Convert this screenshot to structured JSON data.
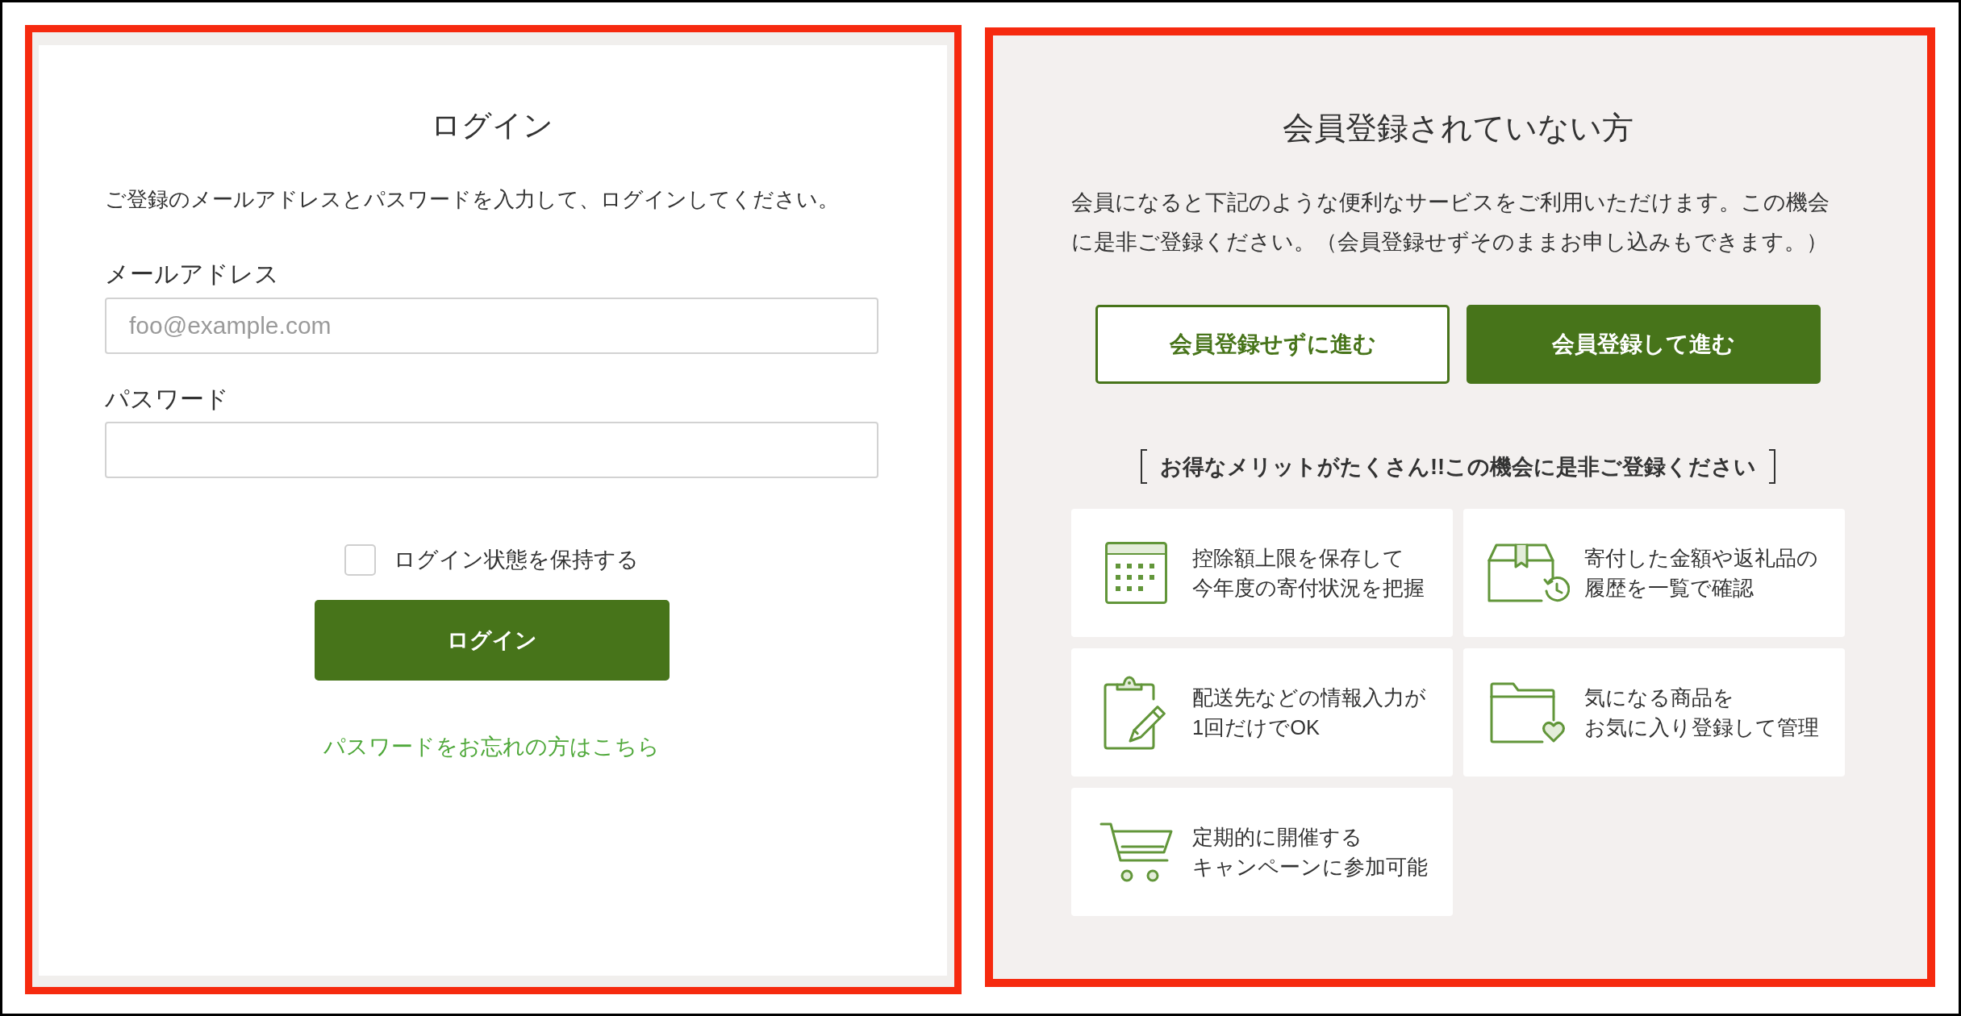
{
  "login": {
    "title": "ログイン",
    "description": "ご登録のメールアドレスとパスワードを入力して、ログインしてください。",
    "fields": [
      {
        "label": "メールアドレス",
        "placeholder": "foo@example.com"
      },
      {
        "label": "パスワード"
      }
    ],
    "remember": {
      "label": "ログイン状態を保持する",
      "checked": false
    },
    "submit_button": "ログイン",
    "forgot_link": "パスワードをお忘れの方はこちら"
  },
  "guest": {
    "title": "会員登録されていない方",
    "description": "会員になると下記のような便利なサービスをご利用いただけます。この機会に是非ご登録ください。（会員登録せずそのままお申し込みもできます。）",
    "buttons": [
      {
        "label": "会員登録せずに進む",
        "kind": "outline"
      },
      {
        "label": "会員登録して進む",
        "kind": "filled"
      }
    ],
    "benefits_heading": "お得なメリットがたくさん!!この機会に是非ご登録ください",
    "benefits": [
      {
        "lines": [
          "控除額上限を保存して",
          "今年度の寄付状況を把握"
        ]
      },
      {
        "lines": [
          "寄付した金額や返礼品の",
          "履歴を一覧で確認"
        ]
      },
      {
        "lines": [
          "配送先などの情報入力が",
          "1回だけでOK"
        ]
      },
      {
        "lines": [
          "気になる商品を",
          "お気に入り登録して管理"
        ]
      },
      {
        "lines": [
          "定期的に開催する",
          "キャンペーンに参加可能"
        ]
      }
    ]
  }
}
